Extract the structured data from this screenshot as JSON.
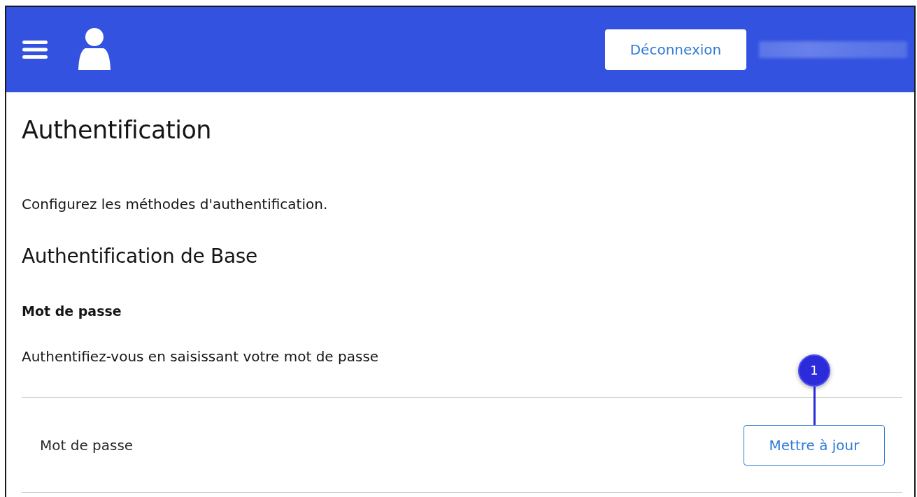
{
  "header": {
    "logout_button": "Déconnexion",
    "username_redacted": true
  },
  "page": {
    "title": "Authentification",
    "description": "Configurez les méthodes d'authentification.",
    "section_title": "Authentification de Base",
    "method_title": "Mot de passe",
    "method_description": "Authentifiez-vous en saisissant votre mot de passe",
    "rows": [
      {
        "label": "Mot de passe",
        "button": "Mettre à jour",
        "callout": "1"
      }
    ]
  }
}
